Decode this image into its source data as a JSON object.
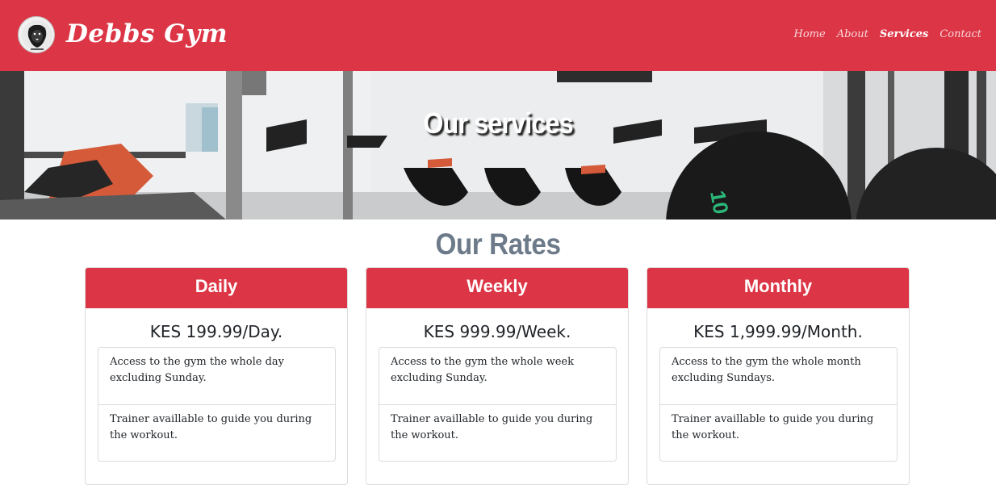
{
  "navbar": {
    "brand": "Debbs Gym",
    "logo_icon": "lion-logo-icon",
    "links": [
      {
        "label": "Home",
        "active": false
      },
      {
        "label": "About",
        "active": false
      },
      {
        "label": "Services",
        "active": true
      },
      {
        "label": "Contact",
        "active": false
      }
    ],
    "background": "#dc3545"
  },
  "hero": {
    "title": "Our services"
  },
  "rates": {
    "heading": "Our Rates",
    "cards": [
      {
        "title": "Daily",
        "price": "KES 199.99/Day.",
        "features": [
          "Access to the gym the whole day excluding Sunday.",
          "Trainer availlable to guide you during the workout."
        ]
      },
      {
        "title": "Weekly",
        "price": "KES 999.99/Week.",
        "features": [
          "Access to the gym the whole week excluding Sunday.",
          "Trainer availlable to guide you during the workout."
        ]
      },
      {
        "title": "Monthly",
        "price": "KES 1,999.99/Month.",
        "features": [
          "Access to the gym the whole month excluding Sundays.",
          "Trainer availlable to guide you during the workout."
        ]
      }
    ]
  },
  "colors": {
    "accent": "#dc3545",
    "heading": "#6c7a89"
  }
}
